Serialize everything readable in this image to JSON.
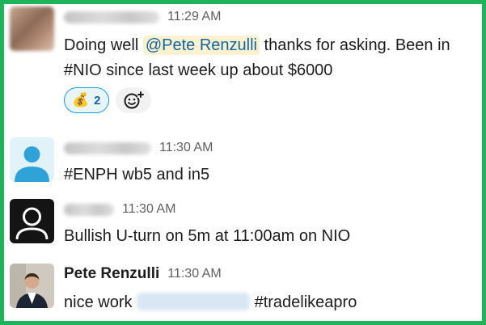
{
  "messages": [
    {
      "time": "11:29 AM",
      "text_before": "Doing well ",
      "mention": "@Pete Renzulli",
      "text_after": " thanks for asking. Been in #NIO since last week up about $6000",
      "reaction": {
        "emoji": "💰",
        "count": "2"
      }
    },
    {
      "time": "11:30 AM",
      "text": "#ENPH wb5 and in5"
    },
    {
      "time": "11:30 AM",
      "text": "Bullish U-turn on 5m at 11:00am on NIO"
    },
    {
      "author": "Pete Renzulli",
      "time": "11:30 AM",
      "text_before": "nice work ",
      "text_after": " #tradelikeapro"
    }
  ],
  "colors": {
    "frame_border": "#1fb35a",
    "mention_bg": "#fdf2d0",
    "mention_text": "#1264a3",
    "reaction_border": "#1d9bd1"
  }
}
